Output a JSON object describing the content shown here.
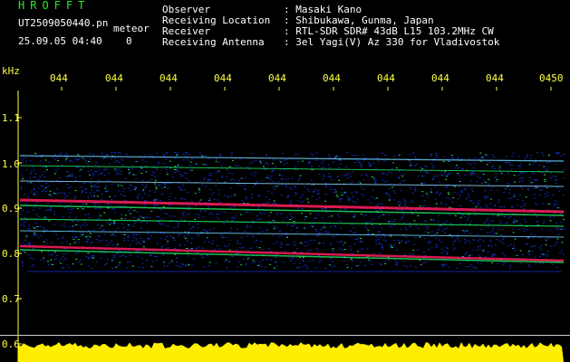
{
  "header": {
    "brand": "HROFFT",
    "filename": "UT2509050440.pn",
    "mode": "meteor",
    "datetime": "25.09.05 04:40",
    "counter": "0"
  },
  "meta": [
    {
      "label": "Observer",
      "value": ": Masaki Kano"
    },
    {
      "label": "Receiving Location",
      "value": ": Shibukawa, Gunma, Japan"
    },
    {
      "label": "Receiver",
      "value": ": RTL-SDR SDR# 43dB L15 103.2MHz CW"
    },
    {
      "label": "Receiving Antenna",
      "value": ": 3el Yagi(V) Az 330 for Vladivostok"
    }
  ],
  "axis": {
    "y_unit": "kHz",
    "x_ticks": [
      "044",
      "044",
      "044",
      "044",
      "044",
      "044",
      "044",
      "044",
      "044",
      "0450"
    ],
    "y_ticks": [
      "1.1",
      "1.0",
      "0.9",
      "0.8",
      "0.7",
      "0.6"
    ]
  },
  "colors": {
    "background": "#000000",
    "tick": "#ffff44",
    "brand": "#22ee22",
    "signal_low": "#1030c0",
    "signal_mid": "#20e060",
    "signal_high": "#ff2060",
    "noise_floor": "#ffee00"
  }
}
